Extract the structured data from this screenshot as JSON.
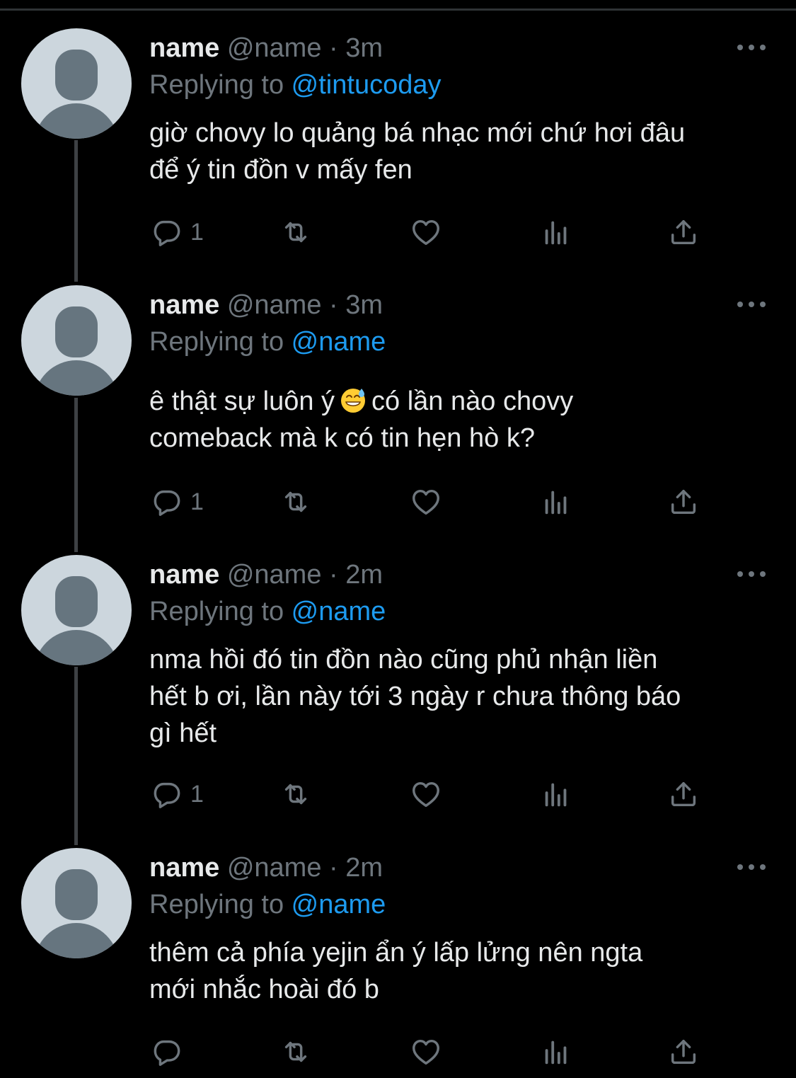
{
  "theme": {
    "background": "#000000",
    "text_primary": "#e7e9ea",
    "text_secondary": "#6e767d",
    "link": "#1d9bf0",
    "avatar_bg": "#ccd6dd",
    "avatar_fg": "#66757f"
  },
  "tweets": [
    {
      "display_name": "name",
      "handle": "@name",
      "separator": "·",
      "time": "3m",
      "replying_prefix": "Replying to ",
      "replying_to": "@tintucoday",
      "text": "giờ chovy lo quảng bá nhạc mới chứ hơi đâu\nđể ý tin đồn v mấy fen",
      "reply_count": "1"
    },
    {
      "display_name": "name",
      "handle": "@name",
      "separator": "·",
      "time": "3m",
      "replying_prefix": "Replying to ",
      "replying_to": "@name",
      "text_before_emoji": "ê thật sự luôn ý",
      "emoji": "grinning-face-with-sweat",
      "text_after_emoji": "có lần nào chovy\ncomeback mà k có tin hẹn hò k?",
      "reply_count": "1"
    },
    {
      "display_name": "name",
      "handle": "@name",
      "separator": "·",
      "time": "2m",
      "replying_prefix": "Replying to ",
      "replying_to": "@name",
      "text": "nma hồi đó tin đồn nào cũng phủ nhận liền\nhết b ơi, lần này tới 3 ngày r chưa thông báo\ngì hết",
      "reply_count": "1"
    },
    {
      "display_name": "name",
      "handle": "@name",
      "separator": "·",
      "time": "2m",
      "replying_prefix": "Replying to ",
      "replying_to": "@name",
      "text": "thêm cả phía yejin ẩn ý lấp lửng nên ngta\nmới nhắc hoài đó b",
      "reply_count": ""
    }
  ],
  "icons": [
    "reply-icon",
    "retweet-icon",
    "like-icon",
    "analytics-icon",
    "share-icon",
    "more-icon"
  ]
}
